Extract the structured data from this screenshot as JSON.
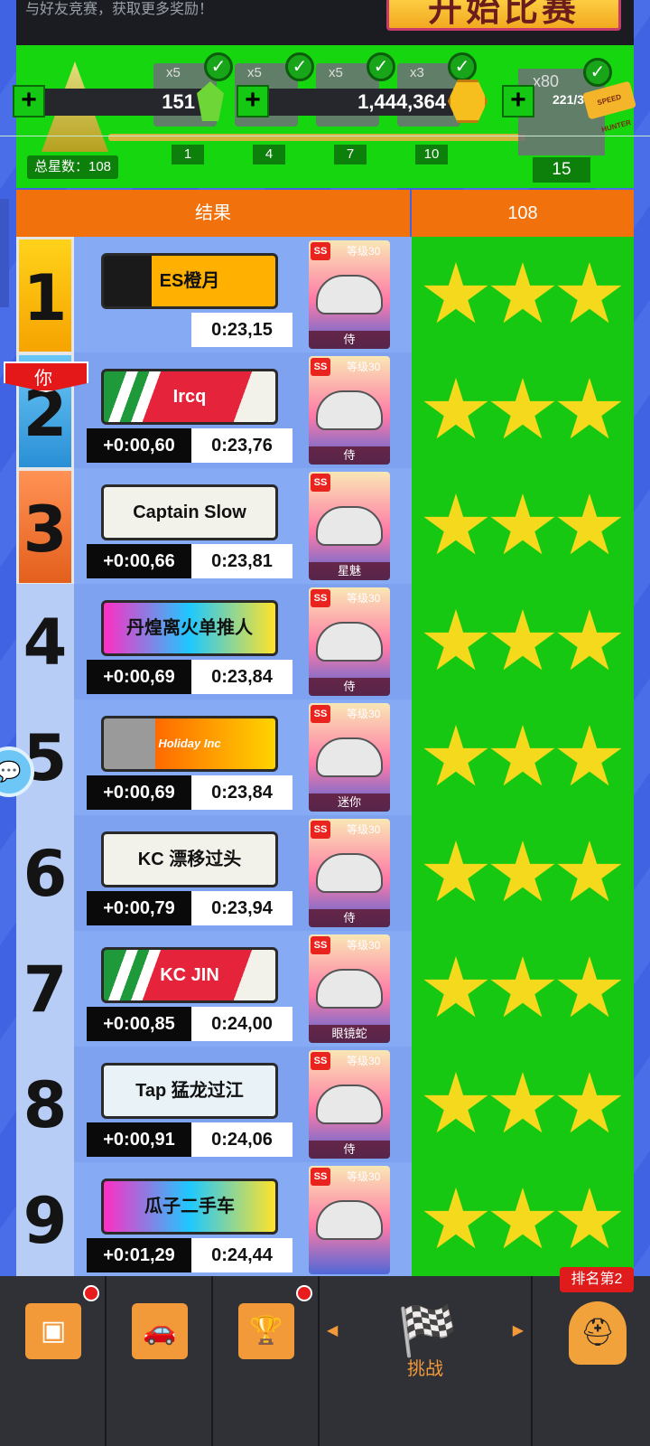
{
  "banner": {
    "text": "与好友竞赛，获取更多奖励！",
    "start_button": "开始比赛"
  },
  "currency": {
    "gems": "151",
    "coins": "1,444,364",
    "tickets": "221/3",
    "ticket_label": "SPEED HUNTER"
  },
  "rewards": {
    "total_stars_label": "总星数：108",
    "boxes": [
      {
        "qty": "x5",
        "milestone": "1"
      },
      {
        "qty": "x5",
        "milestone": "4"
      },
      {
        "qty": "x5",
        "milestone": "7"
      },
      {
        "qty": "x3",
        "milestone": "10"
      }
    ],
    "last": {
      "qty": "x80",
      "milestone": "15"
    }
  },
  "header": {
    "result": "结果",
    "score": "108"
  },
  "you_tag": "你",
  "rows": [
    {
      "rank": "1",
      "plate": "ES橙月",
      "delta": "",
      "time": "0:23,15",
      "level": "等级30",
      "owner": "侍",
      "stars": 3
    },
    {
      "rank": "2",
      "plate": "Ircq",
      "delta": "+0:00,60",
      "time": "0:23,76",
      "level": "等级30",
      "owner": "侍",
      "stars": 3
    },
    {
      "rank": "3",
      "plate": "Captain Slow",
      "delta": "+0:00,66",
      "time": "0:23,81",
      "level": "",
      "owner": "星魅",
      "stars": 3
    },
    {
      "rank": "4",
      "plate": "丹煌离火单推人",
      "delta": "+0:00,69",
      "time": "0:23,84",
      "level": "等级30",
      "owner": "侍",
      "stars": 3
    },
    {
      "rank": "5",
      "plate": "Holiday Inc",
      "delta": "+0:00,69",
      "time": "0:23,84",
      "level": "等级30",
      "owner": "迷你",
      "stars": 3
    },
    {
      "rank": "6",
      "plate": "KC 漂移过头",
      "delta": "+0:00,79",
      "time": "0:23,94",
      "level": "等级30",
      "owner": "侍",
      "stars": 3
    },
    {
      "rank": "7",
      "plate": "KC JIN",
      "delta": "+0:00,85",
      "time": "0:24,00",
      "level": "等级30",
      "owner": "眼镜蛇",
      "stars": 3
    },
    {
      "rank": "8",
      "plate": "Tap 猛龙过江",
      "delta": "+0:00,91",
      "time": "0:24,06",
      "level": "等级30",
      "owner": "侍",
      "stars": 3
    },
    {
      "rank": "9",
      "plate": "瓜子二手车",
      "delta": "+0:01,29",
      "time": "0:24,44",
      "level": "等级30",
      "owner": "",
      "stars": 3
    }
  ],
  "nav": {
    "challenge_label": "挑战",
    "rank_badge": "排名第2"
  },
  "colors": {
    "accent": "#f1720c",
    "green": "#16c811",
    "blue": "#3f63e2"
  }
}
